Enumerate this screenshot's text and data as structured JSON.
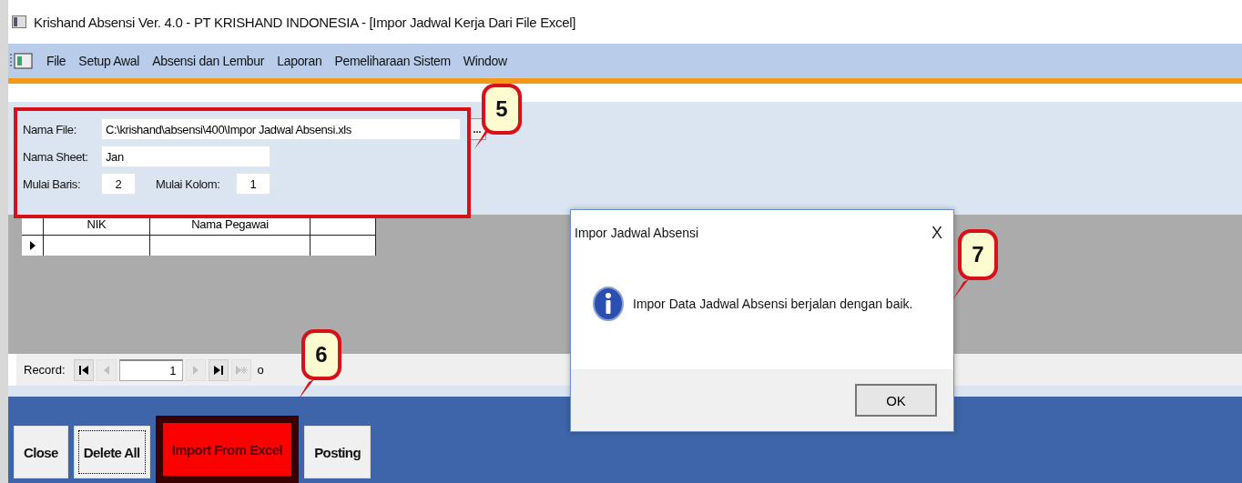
{
  "window": {
    "title": "Krishand Absensi Ver. 4.0 - PT KRISHAND INDONESIA - [Impor Jadwal Kerja Dari File Excel]"
  },
  "menu": [
    {
      "label": "File"
    },
    {
      "label": "Setup Awal"
    },
    {
      "label": "Absensi dan Lembur"
    },
    {
      "label": "Laporan"
    },
    {
      "label": "Pemeliharaan Sistem"
    },
    {
      "label": "Window"
    }
  ],
  "form": {
    "file_label": "Nama File:",
    "file_value": "C:\\krishand\\absensi\\400\\Impor Jadwal Absensi.xls",
    "browse": "...",
    "sheet_label": "Nama Sheet:",
    "sheet_value": "Jan",
    "row_label": "Mulai Baris:",
    "row_value": "2",
    "col_label": "Mulai Kolom:",
    "col_value": "1"
  },
  "grid": {
    "columns": [
      "NIK",
      "Nama Pegawai"
    ],
    "current_row": true
  },
  "record_nav": {
    "label": "Record:",
    "value": "1",
    "of": "o",
    "buttons": [
      {
        "kind": "first",
        "disabled": false
      },
      {
        "kind": "prev",
        "disabled": true
      },
      {
        "kind": "field"
      },
      {
        "kind": "next",
        "disabled": true
      },
      {
        "kind": "last",
        "disabled": false
      },
      {
        "kind": "new",
        "disabled": true
      }
    ]
  },
  "buttons": [
    {
      "label": "Close",
      "focused": false,
      "highlighted": false
    },
    {
      "label": "Delete All",
      "focused": true,
      "highlighted": false
    },
    {
      "label": "Import From Excel",
      "focused": false,
      "highlighted": true
    },
    {
      "label": "Posting",
      "focused": false,
      "highlighted": false
    }
  ],
  "dialog": {
    "title": "Impor Jadwal Absensi",
    "close": "X",
    "message": "Impor Data Jadwal Absensi berjalan dengan baik.",
    "ok": "OK"
  },
  "callouts": [
    {
      "label": "5"
    },
    {
      "label": "6"
    },
    {
      "label": "7"
    }
  ]
}
